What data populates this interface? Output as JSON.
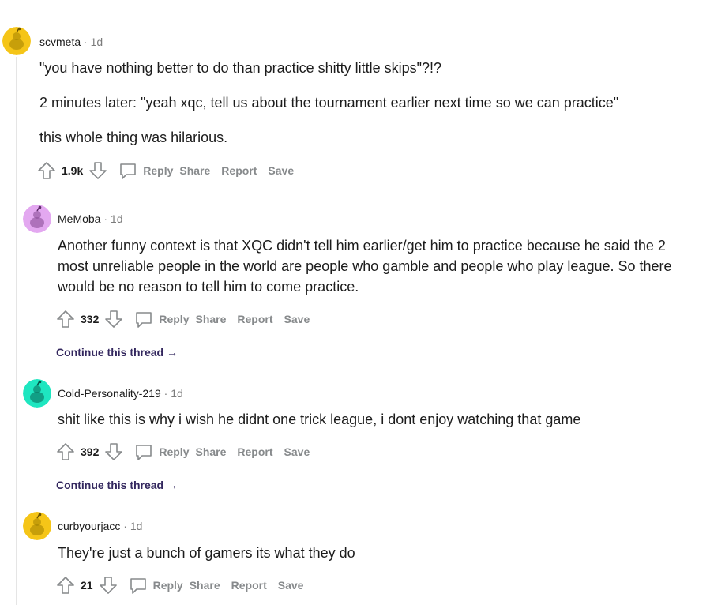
{
  "comments": [
    {
      "username": "scvmeta",
      "age": "1d",
      "paragraphs": [
        "\"you have nothing better to do than practice shitty little skips\"?!?",
        "2 minutes later: \"yeah xqc, tell us about the tournament earlier next time so we can practice\"",
        "this whole thing was hilarious."
      ],
      "score": "1.9k",
      "avatar_color": "#f5c518"
    },
    {
      "username": "MeMoba",
      "age": "1d",
      "paragraphs": [
        "Another funny context is that XQC didn't tell him earlier/get him to practice because he said the 2 most unreliable people in the world are people who gamble and people who play league. So there would be no reason to tell him to come practice."
      ],
      "score": "332",
      "avatar_color": "#e3a8f0",
      "continue_label": "Continue this thread"
    },
    {
      "username": "Cold-Personality-219",
      "age": "1d",
      "paragraphs": [
        "shit like this is why i wish he didnt one trick league, i dont enjoy watching that game"
      ],
      "score": "392",
      "avatar_color": "#1ee6c0",
      "continue_label": "Continue this thread"
    },
    {
      "username": "curbyourjacc",
      "age": "1d",
      "paragraphs": [
        "They're just a bunch of gamers its what they do"
      ],
      "score": "21",
      "avatar_color": "#f5c518"
    }
  ],
  "actions": {
    "reply": "Reply",
    "share": "Share",
    "report": "Report",
    "save": "Save"
  },
  "separator": "·"
}
